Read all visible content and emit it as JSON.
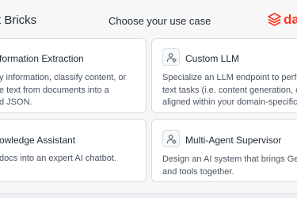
{
  "header": {
    "app_title": "t Bricks",
    "subtitle": "Choose your use case",
    "logo_text": "da",
    "brand_color": "#ff3621"
  },
  "cards": [
    {
      "title": "formation Extraction",
      "desc": [
        "y information, classify content, or",
        "e text from documents into a",
        "d JSON."
      ]
    },
    {
      "title": "Custom LLM",
      "icon": "user-gear-icon",
      "desc": [
        "Specialize an LLM endpoint to perforr",
        "text tasks (i.e. content generation, ch",
        "aligned within your domain-specific g"
      ]
    },
    {
      "title": "owledge Assistant",
      "desc": [
        "docs into an expert AI chatbot."
      ]
    },
    {
      "title": "Multi-Agent Supervisor",
      "icon": "user-gear-icon",
      "desc": [
        "Design an AI system that brings Genie",
        "and tools together."
      ]
    }
  ]
}
